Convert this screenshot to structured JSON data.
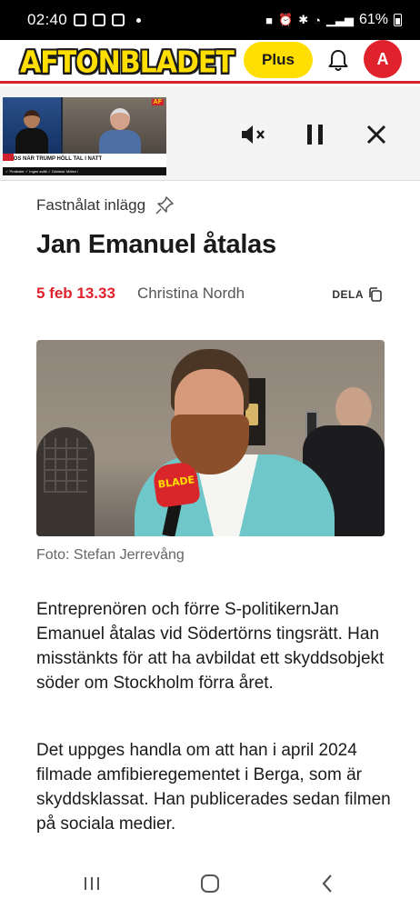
{
  "status_bar": {
    "time": "02:40",
    "battery": "61%"
  },
  "header": {
    "logo": "AFTONBLADET",
    "plus_label": "Plus",
    "avatar_initial": "A",
    "accent_color": "#d3202d",
    "brand_yellow": "#ffde00"
  },
  "player": {
    "thumb_badge": "AF",
    "thumb_caption": "KAOS NÄR TRUMP HÖLL TAL I NATT",
    "thumb_ticker": "✓ Protester  ✓ Ingen svält  ✓ Dödstal: Möten i",
    "icons": {
      "mute": "volume-mute-icon",
      "pause": "pause-icon",
      "close": "close-icon"
    }
  },
  "article": {
    "pinned_label": "Fastnålat inlägg",
    "headline": "Jan Emanuel åtalas",
    "date": "5 feb 13.33",
    "author": "Christina Nordh",
    "share_label": "DELA",
    "photo_mic_text": "BLADE",
    "photo_caption": "Foto: Stefan Jerrevång",
    "paragraphs": [
      "Entreprenören och förre S-politikernJan Emanuel åtalas vid Södertörns tingsrätt. Han misstänkts för att ha avbildat ett skyddsobjekt söder om Stockholm förra året.",
      "Det uppges handla om att han i april 2024 filmade amfibieregementet i Berga, som är skyddsklassat. Han publicerades sedan filmen på sociala medier."
    ]
  },
  "navbar": {
    "icons": {
      "recent": "recent-apps-icon",
      "home": "home-icon",
      "back": "back-icon"
    }
  }
}
